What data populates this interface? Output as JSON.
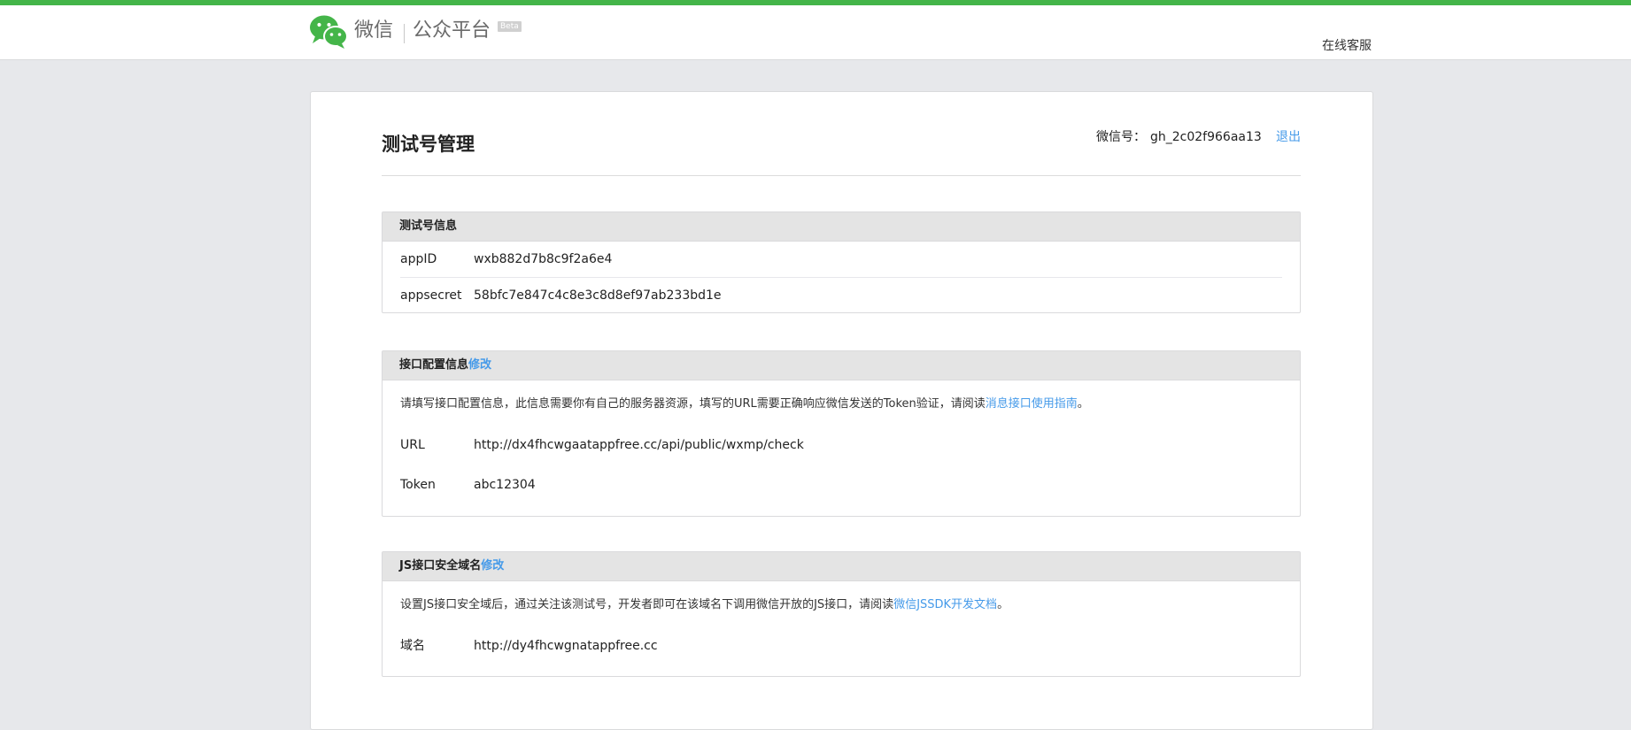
{
  "header": {
    "brand_wechat": "微信",
    "brand_platform": "公众平台",
    "beta": "Beta",
    "service_link": "在线客服"
  },
  "colors": {
    "accent_green": "#44b549",
    "link_blue": "#459ae9",
    "page_background": "#e7e8eb",
    "panel_header": "#e4e4e4"
  },
  "icons": {
    "logo": "wechat-logo-icon"
  },
  "main": {
    "title": "测试号管理",
    "account_label": "微信号：",
    "account_id": "gh_2c02f966aa13",
    "logout": "退出"
  },
  "test_info": {
    "title": "测试号信息",
    "rows": [
      {
        "key": "appID",
        "value": "wxb882d7b8c9f2a6e4"
      },
      {
        "key": "appsecret",
        "value": "58bfc7e847c4c8e3c8d8ef97ab233bd1e"
      }
    ]
  },
  "interface_config": {
    "title": "接口配置信息",
    "edit": "修改",
    "description_prefix": "请填写接口配置信息，此信息需要你有自己的服务器资源，填写的URL需要正确响应微信发送的Token验证，请阅读",
    "description_link": "消息接口使用指南",
    "description_suffix": "。",
    "url_key": "URL",
    "url_value": "http://dx4fhcwgaatappfree.cc/api/public/wxmp/check",
    "token_key": "Token",
    "token_value": "abc12304"
  },
  "js_domain": {
    "title": "JS接口安全域名",
    "edit": "修改",
    "description_prefix": "设置JS接口安全域后，通过关注该测试号，开发者即可在该域名下调用微信开放的JS接口，请阅读",
    "description_link": "微信JSSDK开发文档",
    "description_suffix": "。",
    "domain_key": "域名",
    "domain_value": "http://dy4fhcwgnatappfree.cc"
  }
}
